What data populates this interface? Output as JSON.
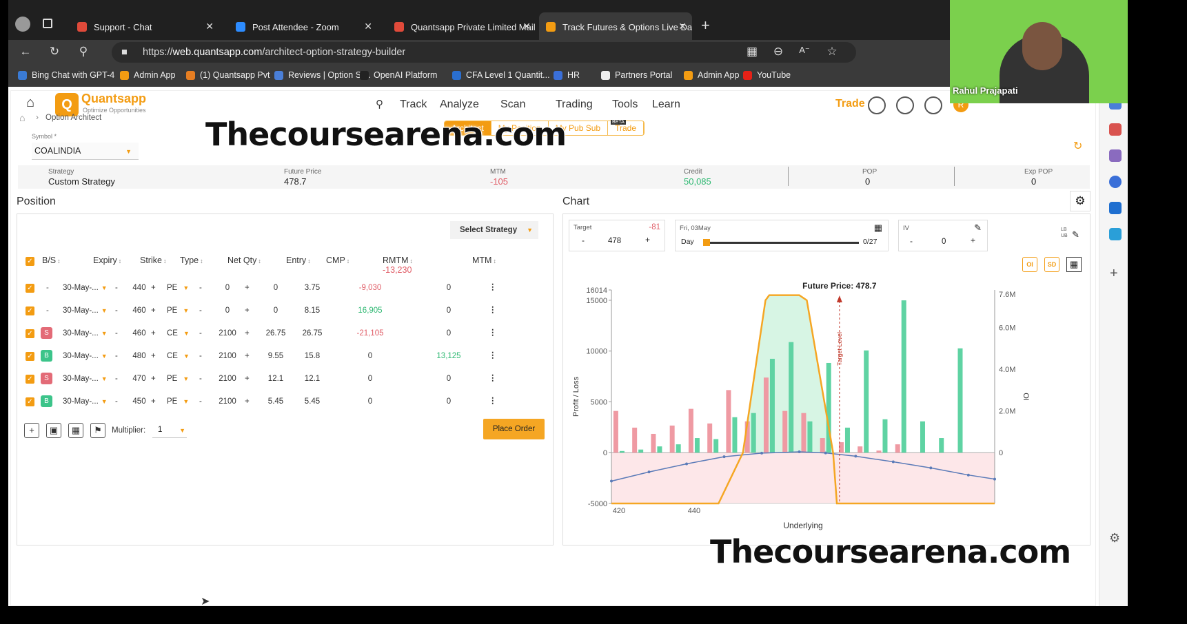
{
  "browser": {
    "tabs": [
      {
        "title": "Support - Chat",
        "icon": "gmail-icon",
        "active": false
      },
      {
        "title": "Post Attendee - Zoom",
        "icon": "zoom-icon",
        "active": false
      },
      {
        "title": "Quantsapp Private Limited Mail",
        "icon": "gmail-icon",
        "active": false
      },
      {
        "title": "Track Futures & Options Live Dat",
        "icon": "quantsapp-icon",
        "active": true
      }
    ],
    "url_prefix": "https://",
    "url_host": "web.quantsapp.com",
    "url_path": "/architect-option-strategy-builder",
    "bookmarks": [
      "Bing Chat with GPT-4",
      "Admin App",
      "(1) Quantsapp Pvt",
      "Reviews | Option St...",
      "OpenAI Platform",
      "CFA Level 1 Quantit...",
      "HR",
      "Partners Portal",
      "Admin App",
      "YouTube"
    ]
  },
  "participant": {
    "name": "Rahul Prajapati"
  },
  "app": {
    "logo_name": "Quantsapp",
    "logo_tagline": "Optimize Opportunities",
    "menu": [
      "Track",
      "Analyze",
      "Scan",
      "Trading",
      "Tools",
      "Learn"
    ],
    "trade_link": "Trade",
    "avatar_letter": "R",
    "breadcrumb": "Option Architect",
    "subtabs": [
      "Architect",
      "My Position",
      "My Pub Sub",
      "Trade"
    ],
    "subtab_badge": "BETA",
    "symbol_label": "Symbol *",
    "symbol_value": "COALINDIA",
    "summary": {
      "strategy_label": "Strategy",
      "strategy_value": "Custom Strategy",
      "future_label": "Future Price",
      "future_value": "478.7",
      "mtm_label": "MTM",
      "mtm_value": "-105",
      "credit_label": "Credit",
      "credit_value": "50,085",
      "pop_label": "POP",
      "pop_value": "0",
      "exppop_label": "Exp POP",
      "exppop_value": "0"
    }
  },
  "watermark": "Thecoursearena.com",
  "position": {
    "title": "Position",
    "select_strategy": "Select Strategy",
    "headers": [
      "B/S",
      "Expiry",
      "Strike",
      "Type",
      "Net Qty",
      "Entry",
      "CMP",
      "RMTM",
      "MTM"
    ],
    "rmtm_total": "-13,230",
    "rows": [
      {
        "bs": "-",
        "expiry": "30-May-...",
        "strike": "440",
        "type": "PE",
        "qty": "0",
        "entry": "0",
        "cmp": "3.75",
        "rmtm": "-9,030",
        "mtm": "0"
      },
      {
        "bs": "-",
        "expiry": "30-May-...",
        "strike": "460",
        "type": "PE",
        "qty": "0",
        "entry": "0",
        "cmp": "8.15",
        "rmtm": "16,905",
        "mtm": "0"
      },
      {
        "bs": "S",
        "expiry": "30-May-...",
        "strike": "460",
        "type": "CE",
        "qty": "2100",
        "entry": "26.75",
        "cmp": "26.75",
        "rmtm": "-21,105",
        "mtm": "0"
      },
      {
        "bs": "B",
        "expiry": "30-May-...",
        "strike": "480",
        "type": "CE",
        "qty": "2100",
        "entry": "9.55",
        "cmp": "15.8",
        "rmtm": "0",
        "mtm": "13,125"
      },
      {
        "bs": "S",
        "expiry": "30-May-...",
        "strike": "470",
        "type": "PE",
        "qty": "2100",
        "entry": "12.1",
        "cmp": "12.1",
        "rmtm": "0",
        "mtm": "0"
      },
      {
        "bs": "B",
        "expiry": "30-May-...",
        "strike": "450",
        "type": "PE",
        "qty": "2100",
        "entry": "5.45",
        "cmp": "5.45",
        "rmtm": "0",
        "mtm": "0"
      }
    ],
    "multiplier_label": "Multiplier:",
    "multiplier_value": "1",
    "place_order": "Place Order"
  },
  "chart_panel": {
    "title": "Chart",
    "target_label": "Target",
    "target_delta": "-81",
    "target_value": "478",
    "date_label": "Fri, 03May",
    "day_label": "Day",
    "day_count": "0/27",
    "iv_label": "IV",
    "iv_value": "0",
    "lb_ub": "LB UB",
    "toggle_oi": "OI",
    "toggle_sd": "SD",
    "future_annotation": "Future Price: 478.7",
    "target_annotation": "Target Level"
  },
  "chart_data": {
    "type": "bar",
    "title": "",
    "xlabel": "Underlying",
    "ylabel": "Profit / Loss",
    "y2label": "OI",
    "ylim": [
      -5000,
      16014
    ],
    "y_ticks": [
      "16014",
      "15000",
      "10000",
      "5000",
      "0",
      "-5000"
    ],
    "y2_ticks": [
      "7.6M",
      "6.0M",
      "4.0M",
      "2.0M",
      "0"
    ],
    "x_ticks": [
      "420",
      "440"
    ],
    "xlim": [
      418,
      520
    ],
    "y2lim": [
      0,
      7600000
    ],
    "payoff_line": [
      [
        418,
        -5000
      ],
      [
        446.5,
        -5000
      ],
      [
        453,
        0
      ],
      [
        459,
        15000
      ],
      [
        460,
        15500
      ],
      [
        468,
        15500
      ],
      [
        470,
        15000
      ],
      [
        477,
        0
      ],
      [
        478,
        -5000
      ],
      [
        520,
        -5000
      ]
    ],
    "t0_curve": [
      [
        418,
        -2800
      ],
      [
        428,
        -1900
      ],
      [
        438,
        -1100
      ],
      [
        448,
        -400
      ],
      [
        458,
        -40
      ],
      [
        468,
        80
      ],
      [
        475,
        -30
      ],
      [
        483,
        -350
      ],
      [
        493,
        -900
      ],
      [
        503,
        -1500
      ],
      [
        513,
        -2200
      ],
      [
        520,
        -2600
      ]
    ],
    "oi_bars": [
      {
        "strike": 420,
        "call_oi": 80000,
        "put_oi": 2000000
      },
      {
        "strike": 425,
        "call_oi": 150000,
        "put_oi": 1200000
      },
      {
        "strike": 430,
        "call_oi": 300000,
        "put_oi": 900000
      },
      {
        "strike": 435,
        "call_oi": 400000,
        "put_oi": 1300000
      },
      {
        "strike": 440,
        "call_oi": 700000,
        "put_oi": 2100000
      },
      {
        "strike": 445,
        "call_oi": 650000,
        "put_oi": 1400000
      },
      {
        "strike": 450,
        "call_oi": 1700000,
        "put_oi": 3000000
      },
      {
        "strike": 455,
        "call_oi": 1900000,
        "put_oi": 1500000
      },
      {
        "strike": 460,
        "call_oi": 4500000,
        "put_oi": 3600000
      },
      {
        "strike": 465,
        "call_oi": 5300000,
        "put_oi": 2000000
      },
      {
        "strike": 470,
        "call_oi": 1500000,
        "put_oi": 1900000
      },
      {
        "strike": 475,
        "call_oi": 4300000,
        "put_oi": 700000
      },
      {
        "strike": 480,
        "call_oi": 1200000,
        "put_oi": 500000
      },
      {
        "strike": 485,
        "call_oi": 4900000,
        "put_oi": 300000
      },
      {
        "strike": 490,
        "call_oi": 1600000,
        "put_oi": 100000
      },
      {
        "strike": 495,
        "call_oi": 7300000,
        "put_oi": 400000
      },
      {
        "strike": 500,
        "call_oi": 1500000,
        "put_oi": 0
      },
      {
        "strike": 505,
        "call_oi": 700000,
        "put_oi": 0
      },
      {
        "strike": 510,
        "call_oi": 5000000,
        "put_oi": 0
      }
    ],
    "future_price": 478.7,
    "colors": {
      "call_oi": "#5fd3a3",
      "put_oi": "#ef9aa3",
      "payoff": "#f5a623",
      "t0": "#5b7bb8"
    }
  }
}
